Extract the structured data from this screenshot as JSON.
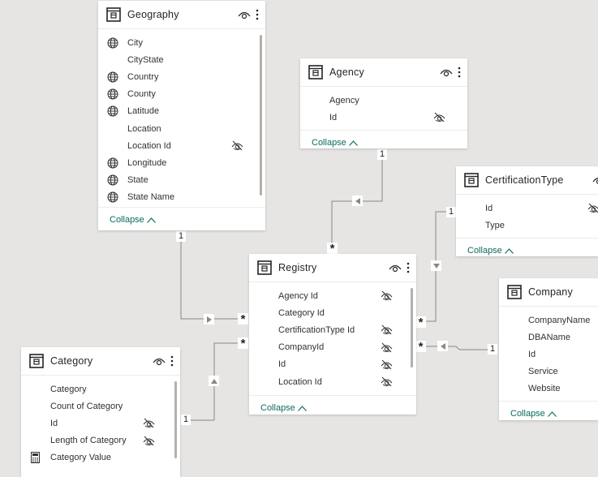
{
  "tables": {
    "geography": {
      "title": "Geography",
      "fields": [
        {
          "name": "City",
          "icon": "globe-icon",
          "hidden": false
        },
        {
          "name": "CityState",
          "icon": "",
          "hidden": false
        },
        {
          "name": "Country",
          "icon": "globe-icon",
          "hidden": false
        },
        {
          "name": "County",
          "icon": "globe-icon",
          "hidden": false
        },
        {
          "name": "Latitude",
          "icon": "globe-icon",
          "hidden": false
        },
        {
          "name": "Location",
          "icon": "",
          "hidden": false
        },
        {
          "name": "Location Id",
          "icon": "",
          "hidden": true
        },
        {
          "name": "Longitude",
          "icon": "globe-icon",
          "hidden": false
        },
        {
          "name": "State",
          "icon": "globe-icon",
          "hidden": false
        },
        {
          "name": "State Name",
          "icon": "globe-icon",
          "hidden": false
        }
      ],
      "collapse_label": "Collapse"
    },
    "agency": {
      "title": "Agency",
      "fields": [
        {
          "name": "Agency",
          "icon": "",
          "hidden": false
        },
        {
          "name": "Id",
          "icon": "",
          "hidden": true
        }
      ],
      "collapse_label": "Collapse"
    },
    "certification_type": {
      "title": "CertificationType",
      "fields": [
        {
          "name": "Id",
          "icon": "",
          "hidden": true
        },
        {
          "name": "Type",
          "icon": "",
          "hidden": false
        }
      ],
      "collapse_label": "Collapse"
    },
    "registry": {
      "title": "Registry",
      "fields": [
        {
          "name": "Agency Id",
          "icon": "",
          "hidden": true
        },
        {
          "name": "Category Id",
          "icon": "",
          "hidden": false
        },
        {
          "name": "CertificationType Id",
          "icon": "",
          "hidden": true
        },
        {
          "name": "CompanyId",
          "icon": "",
          "hidden": true
        },
        {
          "name": "Id",
          "icon": "",
          "hidden": true
        },
        {
          "name": "Location Id",
          "icon": "",
          "hidden": true
        }
      ],
      "collapse_label": "Collapse"
    },
    "company": {
      "title": "Company",
      "fields": [
        {
          "name": "CompanyName",
          "icon": "",
          "hidden": false
        },
        {
          "name": "DBAName",
          "icon": "",
          "hidden": false
        },
        {
          "name": "Id",
          "icon": "",
          "hidden": false
        },
        {
          "name": "Service",
          "icon": "",
          "hidden": false
        },
        {
          "name": "Website",
          "icon": "",
          "hidden": false
        }
      ],
      "collapse_label": "Collapse"
    },
    "category": {
      "title": "Category",
      "fields": [
        {
          "name": "Category",
          "icon": "",
          "hidden": false
        },
        {
          "name": "Count of Category",
          "icon": "",
          "hidden": false
        },
        {
          "name": "Id",
          "icon": "",
          "hidden": true
        },
        {
          "name": "Length of Category",
          "icon": "",
          "hidden": true
        },
        {
          "name": "Category Value",
          "icon": "calculator-icon",
          "hidden": false
        }
      ]
    }
  },
  "relationships": [
    {
      "from": "Geography",
      "to": "Registry",
      "from_cardinality": "1",
      "to_cardinality": "*",
      "direction": "right"
    },
    {
      "from": "Agency",
      "to": "Registry",
      "from_cardinality": "1",
      "to_cardinality": "*",
      "direction": "left"
    },
    {
      "from": "CertificationType",
      "to": "Registry",
      "from_cardinality": "1",
      "to_cardinality": "*",
      "direction": "down"
    },
    {
      "from": "Company",
      "to": "Registry",
      "from_cardinality": "1",
      "to_cardinality": "*",
      "direction": "left"
    },
    {
      "from": "Category",
      "to": "Registry",
      "from_cardinality": "1",
      "to_cardinality": "*",
      "direction": "up"
    }
  ],
  "colors": {
    "accent": "#0b6a5c",
    "background": "#e6e5e4",
    "line": "#8a8886"
  }
}
